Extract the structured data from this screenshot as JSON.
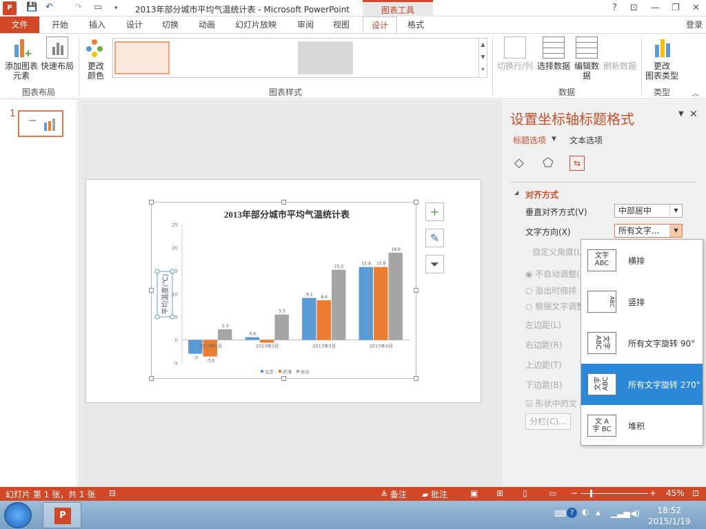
{
  "titlebar": {
    "logo": "P",
    "doc_title": "2013年部分城市平均气温统计表 - Microsoft PowerPoint",
    "context_tab": "图表工具",
    "help": "?",
    "min": "—",
    "restore": "❐",
    "close": "✕"
  },
  "tabs": {
    "file": "文件",
    "items": [
      "开始",
      "插入",
      "设计",
      "切换",
      "动画",
      "幻灯片放映",
      "审阅",
      "视图",
      "设计",
      "格式"
    ],
    "login": "登录"
  },
  "ribbon": {
    "add_element": "添加图表\n元素",
    "quick_layout": "快速布局",
    "change_color": "更改\n颜色",
    "group_layout": "图表布局",
    "group_styles": "图表样式",
    "switch_rowcol": "切换行/列",
    "select_data": "选择数据",
    "edit_data": "编辑数\n据",
    "refresh_data": "刷新数据",
    "group_data": "数据",
    "change_type": "更改\n图表类型",
    "group_type": "类型"
  },
  "slide_pane": {
    "slide_number": "1"
  },
  "chart_data": {
    "type": "bar",
    "title": "2013年部分城市平均气温统计表",
    "ylabel": "平均温度(℃)",
    "categories": [
      "2013年1月",
      "2013年2月",
      "2013年3月",
      "2013年4月"
    ],
    "series": [
      {
        "name": "北京",
        "values": [
          -3,
          0.6,
          9.1,
          15.8
        ],
        "color": "#5b9bd5"
      },
      {
        "name": "天津",
        "values": [
          -3.6,
          -0.6,
          8.6,
          15.8
        ],
        "color": "#ed7d31"
      },
      {
        "name": "长沙",
        "values": [
          2.3,
          5.5,
          15.2,
          18.9
        ],
        "color": "#a5a5a5"
      }
    ],
    "data_labels": [
      [
        "-3",
        "0.6",
        "9.1",
        "15.8"
      ],
      [
        "-3.6",
        "",
        "8.6",
        "15.8"
      ],
      [
        "2.3",
        "5.5",
        "15.2",
        "18.9"
      ]
    ],
    "ylim": [
      -5,
      25
    ],
    "yticks": [
      "25",
      "20",
      "15",
      "10",
      "5",
      "0",
      "-5"
    ],
    "legend_position": "bottom"
  },
  "format_pane": {
    "title": "设置坐标轴标题格式",
    "tab_title": "标题选项",
    "tab_text": "文本选项",
    "section": "对齐方式",
    "vertical_align_label": "垂直对齐方式(V)",
    "vertical_align_value": "中部居中",
    "text_dir_label": "文字方向(X)",
    "text_dir_value": "所有文字...",
    "custom_angle": "自定义角度(L",
    "no_autofit": "不自动调整(",
    "shrink": "溢出时缩排",
    "resize": "根据文字调整",
    "left_margin": "左边距(L)",
    "right_margin": "右边距(R)",
    "top_margin": "上边距(T)",
    "bottom_margin": "下边距(B)",
    "wrap": "形状中的文",
    "columns": "分栏(C)..."
  },
  "dropdown": {
    "options": [
      {
        "label": "横排",
        "icon": "文字\nABC"
      },
      {
        "label": "竖排",
        "icon": "ABC"
      },
      {
        "label": "所有文字旋转 90°",
        "icon": "文字\nABC"
      },
      {
        "label": "所有文字旋转 270°",
        "icon": "文字\nABC"
      },
      {
        "label": "堆积",
        "icon": "文 A\n字 BC"
      }
    ]
  },
  "status": {
    "slide_info": "幻灯片 第 1 张，共 1 张",
    "notes": "备注",
    "comments": "批注",
    "zoom": "45%"
  },
  "taskbar": {
    "time": "18:52",
    "date": "2015/1/19"
  }
}
